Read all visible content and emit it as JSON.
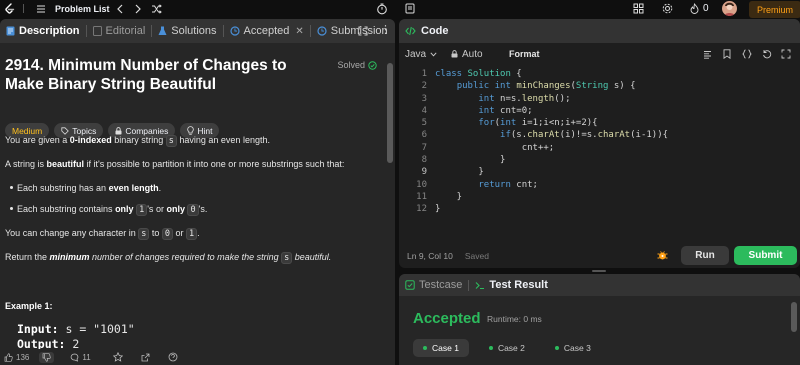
{
  "topbar": {
    "problem_list": "Problem List",
    "streak_count": "0",
    "premium": "Premium"
  },
  "left_tabs": {
    "description": "Description",
    "editorial": "Editorial",
    "solutions": "Solutions",
    "accepted": "Accepted",
    "submissions": "Submission"
  },
  "problem": {
    "title": "2914. Minimum Number of Changes to Make Binary String Beautiful",
    "status": "Solved",
    "difficulty": "Medium",
    "chips": [
      "Topics",
      "Companies",
      "Hint"
    ],
    "p1": {
      "a": "You are given a ",
      "b": "0-indexed",
      "c": " binary string ",
      "code": "s",
      "d": " having an even length."
    },
    "p2": {
      "a": "A string is ",
      "b": "beautiful",
      "c": " if it's possible to partition it into one or more substrings such that:"
    },
    "b1": {
      "a": "Each substring has an ",
      "b": "even length",
      "c": "."
    },
    "b2": {
      "a": "Each substring contains ",
      "b": "only",
      "code1": "1",
      "c": "'s or ",
      "d": "only",
      "code2": "0",
      "e": "'s."
    },
    "p3": {
      "a": "You can change any character in ",
      "code1": "s",
      "b": " to ",
      "code2": "0",
      "c": " or ",
      "code3": "1",
      "d": "."
    },
    "p4": {
      "a": "Return the ",
      "b": "minimum",
      "c": " number of changes required to make the string ",
      "code": "s",
      "d": " beautiful."
    },
    "example_title": "Example 1:",
    "example_input_label": "Input:",
    "example_input_value": " s = \"1001\"",
    "example_output_label": "Output:",
    "example_output_value": " 2"
  },
  "left_footer": {
    "likes": "136",
    "comments": "11"
  },
  "code_panel": {
    "title": "Code",
    "language": "Java",
    "auto": "Auto",
    "format": "Format",
    "line_numbers": [
      "1",
      "2",
      "3",
      "4",
      "5",
      "6",
      "7",
      "8",
      "9",
      "10",
      "11",
      "12"
    ],
    "cursor": "Ln 9, Col 10",
    "saved": "Saved",
    "run": "Run",
    "submit": "Submit"
  },
  "result_panel": {
    "testcase_tab": "Testcase",
    "result_tab": "Test Result",
    "verdict": "Accepted",
    "runtime": "Runtime: 0 ms",
    "cases": [
      "Case 1",
      "Case 2",
      "Case 3"
    ]
  },
  "colors": {
    "accent_green": "#2cbb5d",
    "medium": "#ffc01e",
    "premium": "#ffa116"
  }
}
